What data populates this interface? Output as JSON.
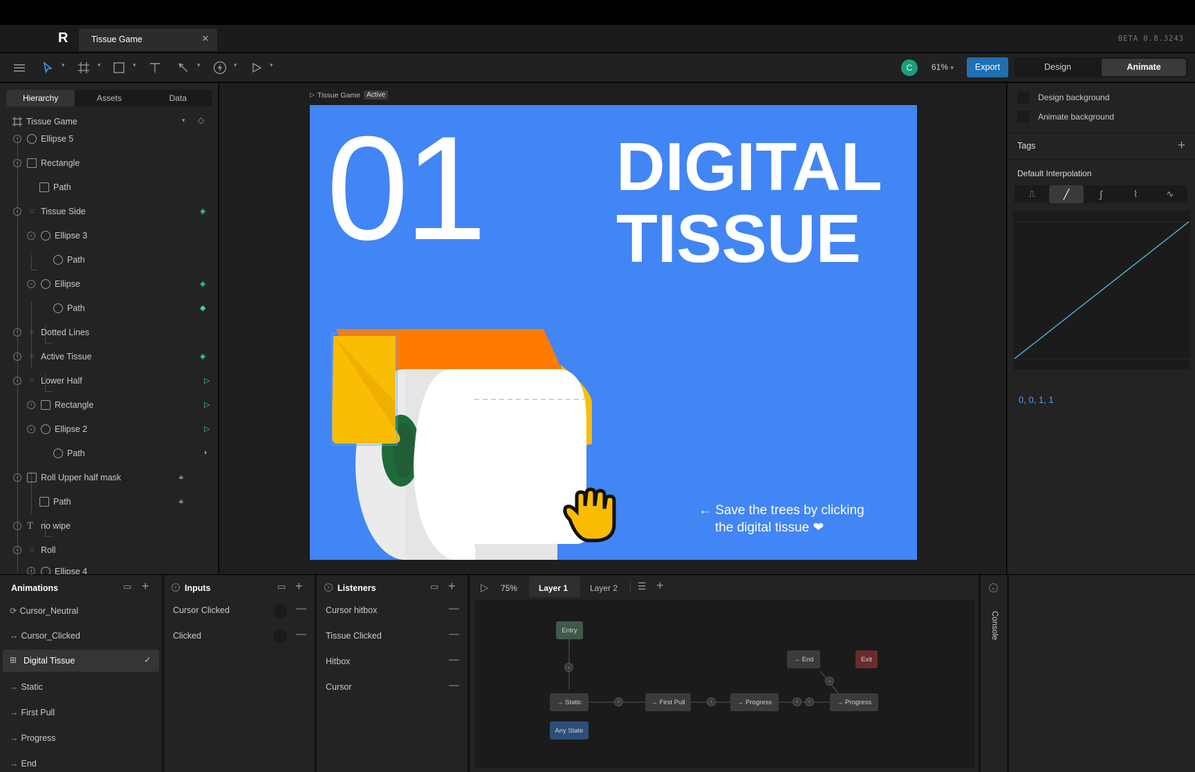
{
  "app": {
    "logo": "R",
    "doc_tab": "Tissue Game",
    "doc_tab_close": "×",
    "version": "BETA 0.8.3243"
  },
  "toolbar": {
    "avatar": "C",
    "zoom": "61%",
    "export_label": "Export",
    "mode_design": "Design",
    "mode_animate": "Animate",
    "icons": [
      "menu-icon",
      "select-icon",
      "frame-icon",
      "shape-icon",
      "text-icon",
      "pen-icon",
      "bolt-icon",
      "play-icon"
    ]
  },
  "left_tabs": {
    "hierarchy": "Hierarchy",
    "assets": "Assets",
    "data": "Data"
  },
  "hierarchy": {
    "root": "Tissue Game",
    "items": [
      {
        "label": "Ellipse 5"
      },
      {
        "label": "Rectangle"
      },
      {
        "label": "Path"
      },
      {
        "label": "Tissue Side"
      },
      {
        "label": "Ellipse 3"
      },
      {
        "label": "Path"
      },
      {
        "label": "Ellipse"
      },
      {
        "label": "Path"
      },
      {
        "label": "Dotted Lines"
      },
      {
        "label": "Active Tissue"
      },
      {
        "label": "Lower Half"
      },
      {
        "label": "Rectangle"
      },
      {
        "label": "Ellipse 2"
      },
      {
        "label": "Path"
      },
      {
        "label": "Roll Upper half mask"
      },
      {
        "label": "Path"
      },
      {
        "label": "no wipe"
      },
      {
        "label": "Roll"
      },
      {
        "label": "Ellipse 4"
      }
    ]
  },
  "stage": {
    "artboard_label": "Tissue Game",
    "artboard_badge": "Active",
    "number": "01",
    "title_line1": "DIGITAL",
    "title_line2": "TISSUE",
    "caption_line1": "← Save the trees by clicking",
    "caption_line2": "the digital tissue ❤"
  },
  "right_panel": {
    "design_bg": "Design background",
    "animate_bg": "Animate background",
    "tags": "Tags",
    "interp_title": "Default Interpolation",
    "interp_values": "0, 0, 1, 1"
  },
  "animations": {
    "title": "Animations",
    "items": [
      "Cursor_Neutral",
      "Cursor_Clicked",
      "Digital Tissue",
      "Static",
      "First Pull",
      "Progress",
      "End"
    ]
  },
  "inputs": {
    "title": "Inputs",
    "items": [
      "Cursor Clicked",
      "Clicked"
    ]
  },
  "listeners": {
    "title": "Listeners",
    "items": [
      "Cursor hitbox",
      "Tissue Clicked",
      "Hitbox",
      "Cursor"
    ]
  },
  "state_machine": {
    "zoom": "75%",
    "layer1": "Layer 1",
    "layer2": "Layer 2",
    "nodes": {
      "entry": "Entry",
      "static": "→ Static",
      "first_pull": "→ First Pull",
      "progress1": "→ Progress",
      "progress2": "→ Progress",
      "end": "→ End",
      "exit": "Exit",
      "any_state": "Any State"
    }
  },
  "console": "Console",
  "colors": {
    "accent": "#1f6fb2",
    "artboard": "#4285f4",
    "teal": "#3ecfb4"
  }
}
